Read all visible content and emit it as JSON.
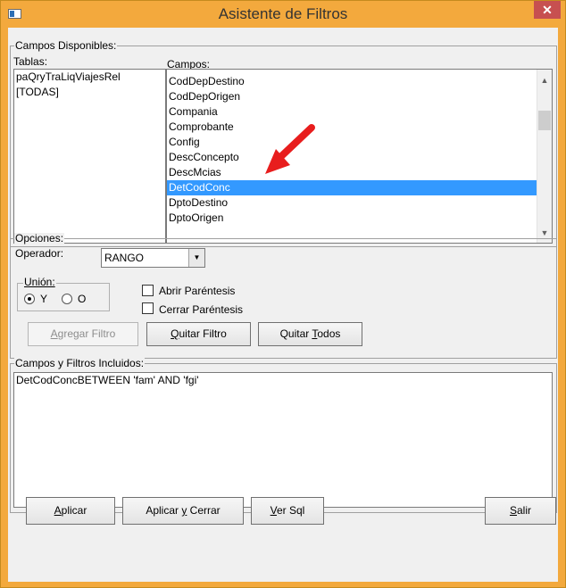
{
  "window": {
    "title": "Asistente de Filtros",
    "close_glyph": "✕",
    "title_color": "#f3a93d",
    "accent_selection": "#3399ff"
  },
  "campos_disponibles": {
    "group_label": "Campos Disponibles:",
    "tablas_label": "Tablas:",
    "campos_label": "Campos:",
    "tablas": [
      "paQryTraLiqViajesRel",
      "[TODAS]"
    ],
    "campos": [
      "CodDepDestino",
      "CodDepOrigen",
      "Compania",
      "Comprobante",
      "Config",
      "DescConcepto",
      "DescMcias",
      "DetCodConc",
      "DptoDestino",
      "DptoOrigen"
    ],
    "selected_campo": "DetCodConc",
    "scroll_up_glyph": "▲",
    "scroll_down_glyph": "▼",
    "annotation_icon": "red-arrow-icon"
  },
  "opciones": {
    "group_label": "Opciones:",
    "operador_label": "Operador:",
    "operador_value": "RANGO",
    "dropdown_glyph": "▼",
    "union_label": "Unión:",
    "union_y": "Y",
    "union_o": "O",
    "abrir_parentesis": "Abrir Paréntesis",
    "cerrar_parentesis": "Cerrar Paréntesis",
    "agregar_filtro_prefix": "",
    "agregar_filtro_u": "A",
    "agregar_filtro_rest": "gregar Filtro",
    "quitar_filtro_u": "Q",
    "quitar_filtro_rest": "uitar Filtro",
    "quitar_todos_pre": "Quitar ",
    "quitar_todos_u": "T",
    "quitar_todos_rest": "odos"
  },
  "incluidos": {
    "group_label": "Campos y Filtros Incluidos:",
    "text": "DetCodConcBETWEEN 'fam' AND 'fgi'"
  },
  "bottom_buttons": {
    "aplicar_u": "A",
    "aplicar_rest": "plicar",
    "aplicar_cerrar_pre": "Aplicar ",
    "aplicar_cerrar_u": "y",
    "aplicar_cerrar_rest": " Cerrar",
    "ver_sql_u": "V",
    "ver_sql_rest": "er Sql",
    "salir_u": "S",
    "salir_rest": "alir"
  }
}
